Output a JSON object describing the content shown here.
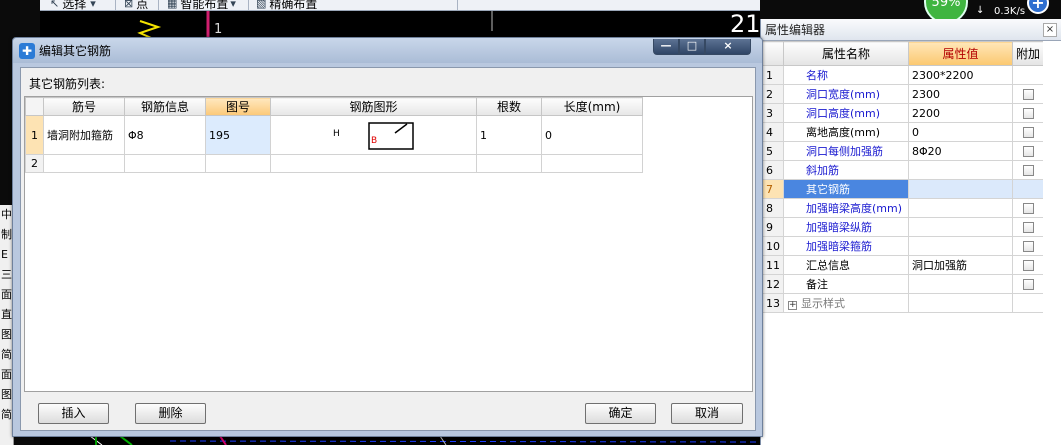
{
  "background": {
    "toolbar_items": [
      {
        "icon": "pointer-icon",
        "label": "选择"
      },
      {
        "icon": "point-icon",
        "label": "点"
      },
      {
        "icon": "smart-layout-icon",
        "label": "智能布置"
      },
      {
        "icon": "precise-layout-icon",
        "label": "精确布置"
      }
    ],
    "canvas_text": "1",
    "big_number": "21",
    "left_strip_chars": [
      "中",
      "制",
      "E",
      "三",
      "面",
      "直",
      "图",
      "简",
      "面",
      "图",
      "简"
    ]
  },
  "speed_widget": {
    "percent": "59%",
    "arrow": "↓",
    "rate": "0.3K/s",
    "plus_label": "+"
  },
  "property_editor": {
    "title": "属性编辑器",
    "close_label": "×",
    "headers": [
      "属性名称",
      "属性值",
      "附加"
    ],
    "rows": [
      {
        "index": "1",
        "name": "名称",
        "value": "2300*2200",
        "style": "blue",
        "checkbox": false
      },
      {
        "index": "2",
        "name": "洞口宽度(mm)",
        "value": "2300",
        "style": "blue",
        "checkbox": true
      },
      {
        "index": "3",
        "name": "洞口高度(mm)",
        "value": "2200",
        "style": "blue",
        "checkbox": true
      },
      {
        "index": "4",
        "name": "离地高度(mm)",
        "value": "0",
        "style": "black",
        "checkbox": true
      },
      {
        "index": "5",
        "name": "洞口每侧加强筋",
        "value": "8Φ20",
        "style": "blue",
        "checkbox": true
      },
      {
        "index": "6",
        "name": "斜加筋",
        "value": "",
        "style": "blue",
        "checkbox": true
      },
      {
        "index": "7",
        "name": "其它钢筋",
        "value": "",
        "style": "selected",
        "checkbox": false
      },
      {
        "index": "8",
        "name": "加强暗梁高度(mm)",
        "value": "",
        "style": "blue",
        "checkbox": true
      },
      {
        "index": "9",
        "name": "加强暗梁纵筋",
        "value": "",
        "style": "blue",
        "checkbox": true
      },
      {
        "index": "10",
        "name": "加强暗梁箍筋",
        "value": "",
        "style": "blue",
        "checkbox": true
      },
      {
        "index": "11",
        "name": "汇总信息",
        "value": "洞口加强筋",
        "style": "black",
        "checkbox": true
      },
      {
        "index": "12",
        "name": "备注",
        "value": "",
        "style": "black",
        "checkbox": true
      },
      {
        "index": "13",
        "name": "显示样式",
        "value": "",
        "style": "gray",
        "checkbox": false,
        "expand": "+"
      }
    ]
  },
  "dialog": {
    "title": "编辑其它钢筋",
    "min_label": "—",
    "max_label": "□",
    "close_label": "×",
    "list_label": "其它钢筋列表:",
    "columns": [
      "筋号",
      "钢筋信息",
      "图号",
      "钢筋图形",
      "根数",
      "长度(mm)"
    ],
    "rows": [
      {
        "index": "1",
        "bar_name": "墙洞附加箍筋",
        "bar_info": "Φ8",
        "figure_no": "195",
        "shape_h": "H",
        "shape_b": "B",
        "count": "1",
        "length": "0"
      },
      {
        "index": "2",
        "bar_name": "",
        "bar_info": "",
        "figure_no": "",
        "shape_h": "",
        "shape_b": "",
        "count": "",
        "length": ""
      }
    ],
    "buttons": {
      "insert": "插入",
      "delete": "删除",
      "ok": "确定",
      "cancel": "取消"
    }
  }
}
